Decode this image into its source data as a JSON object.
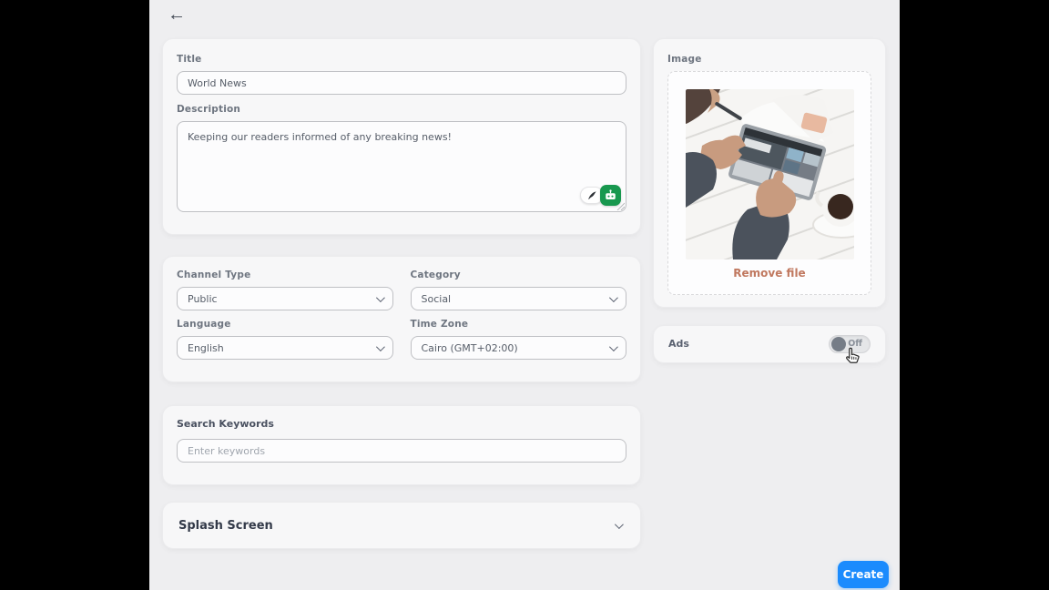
{
  "nav": {
    "back_label": "←"
  },
  "form": {
    "title": {
      "label": "Title",
      "value": "World News"
    },
    "description": {
      "label": "Description",
      "value": "Keeping our readers informed of any breaking news!"
    },
    "channel_type": {
      "label": "Channel Type",
      "value": "Public"
    },
    "category": {
      "label": "Category",
      "value": "Social"
    },
    "language": {
      "label": "Language",
      "value": "English"
    },
    "time_zone": {
      "label": "Time Zone",
      "value": "Cairo (GMT+02:00)"
    },
    "search_keywords": {
      "label": "Search Keywords",
      "placeholder": "Enter keywords"
    },
    "splash_screen": {
      "label": "Splash Screen"
    }
  },
  "image_panel": {
    "label": "Image",
    "remove_file_label": "Remove file"
  },
  "ads_panel": {
    "label": "Ads",
    "toggle_state": "Off"
  },
  "actions": {
    "create_label": "Create"
  },
  "colors": {
    "accent_blue": "#1b8bfd",
    "remove_link": "#c0785f",
    "ai_badge_green": "#18984f",
    "toggle_knob": "#767d87"
  }
}
